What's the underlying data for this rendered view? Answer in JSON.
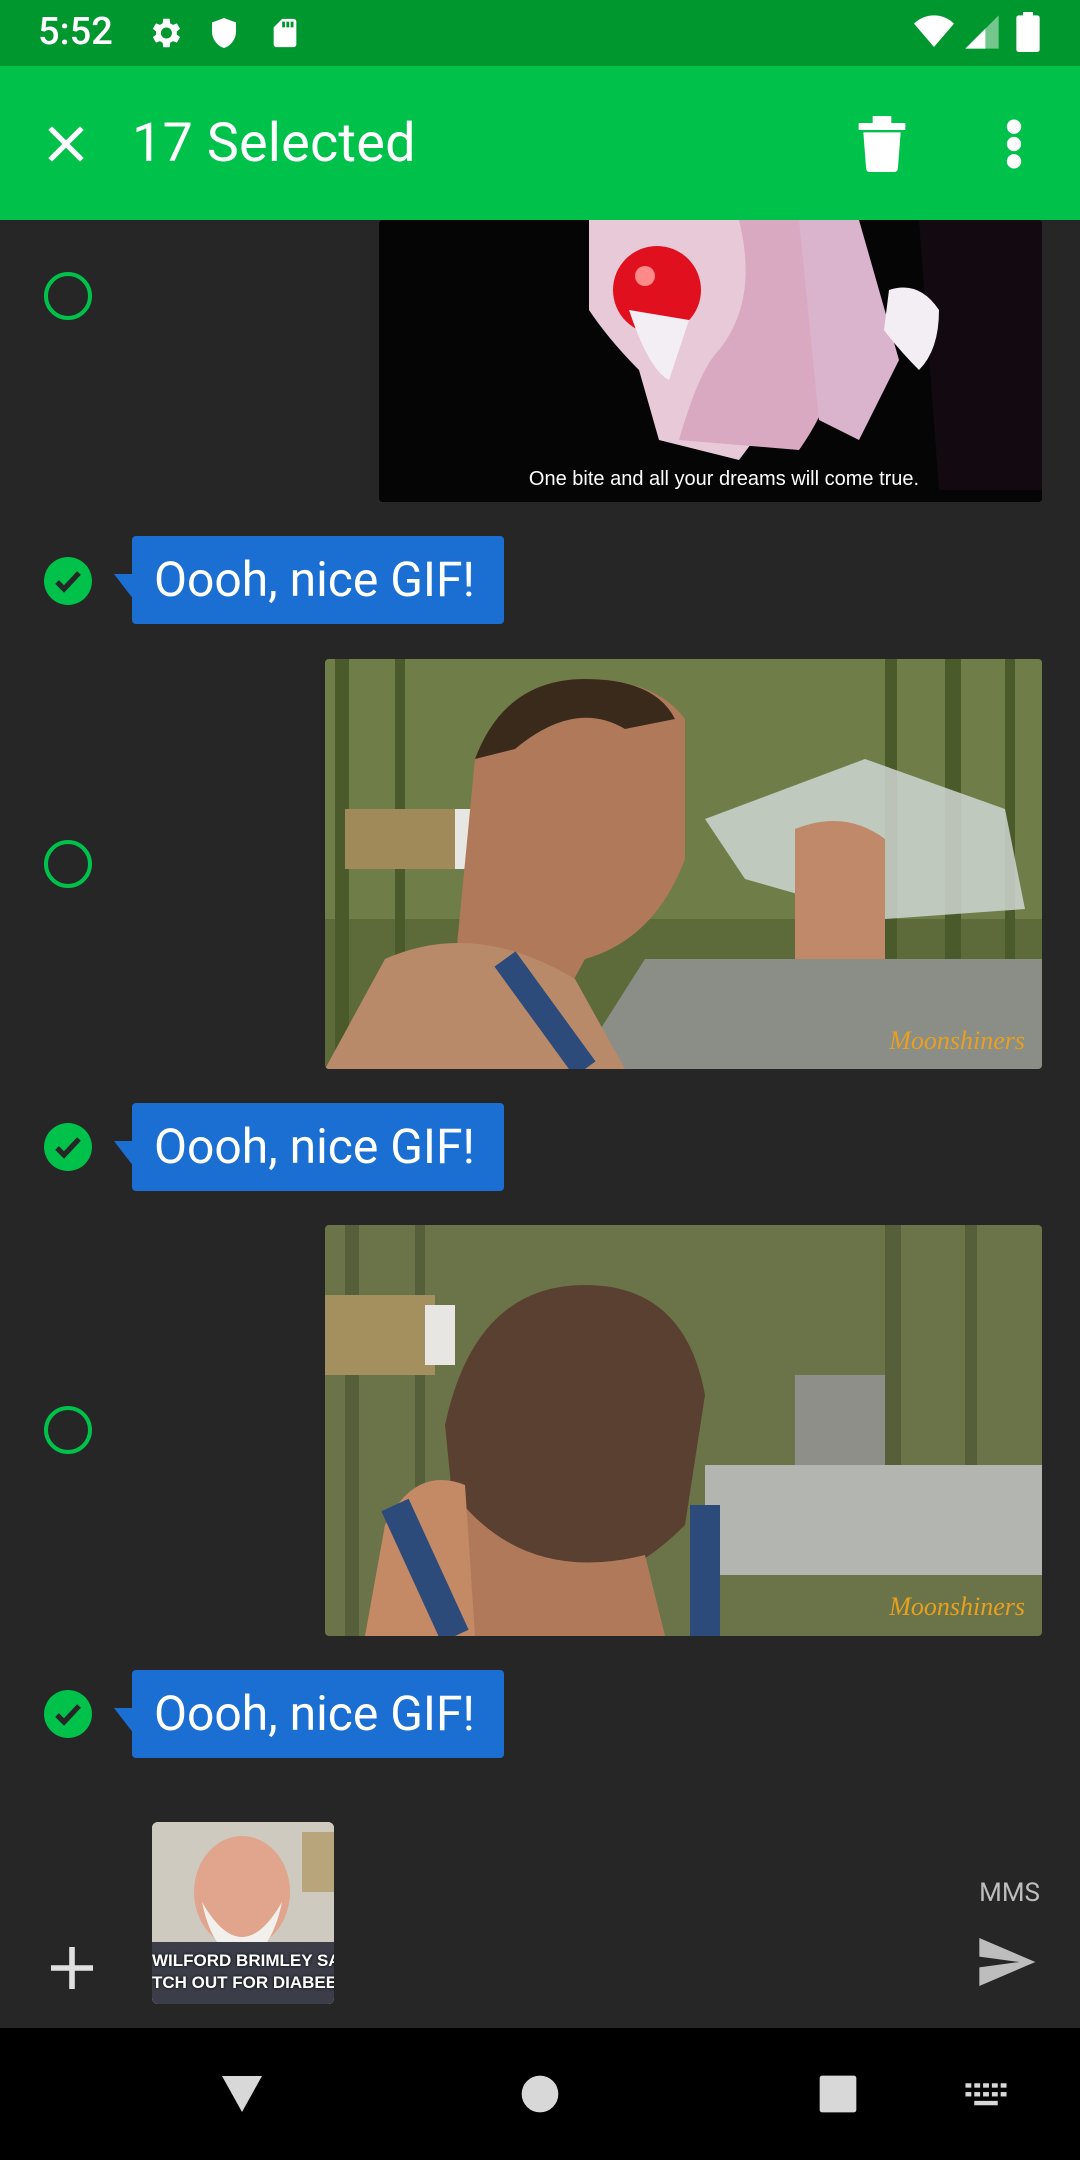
{
  "status": {
    "time": "5:52"
  },
  "appbar": {
    "title": "17 Selected"
  },
  "messages": {
    "m1_caption": "One bite and all your dreams will come true.",
    "m2_text": "Oooh, nice GIF!",
    "m3_watermark": "Moonshiners",
    "m4_text": "Oooh, nice GIF!",
    "m5_watermark": "Moonshiners",
    "m6_text": "Oooh, nice GIF!"
  },
  "composer": {
    "attachment_caption_1": "WILFORD BRIMLEY SAYS:",
    "attachment_caption_2": "TCH OUT FOR DIABEETU",
    "mms_label": "MMS"
  },
  "colors": {
    "accent": "#00c24a",
    "status": "#00972f",
    "bubble": "#1b6fd2",
    "background": "#262626"
  }
}
